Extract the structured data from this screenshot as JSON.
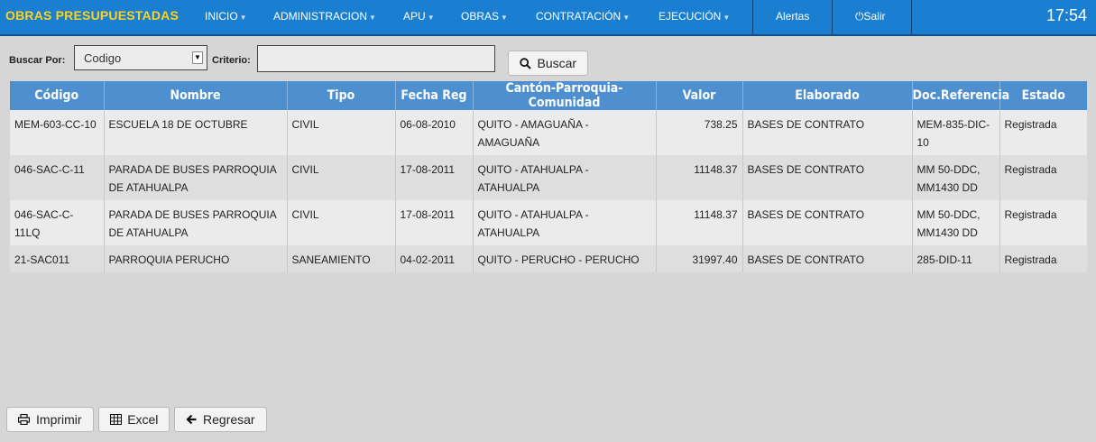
{
  "nav": {
    "brand": "OBRAS PRESUPUESTADAS",
    "menu": [
      {
        "label": "INICIO"
      },
      {
        "label": "ADMINISTRACION"
      },
      {
        "label": "APU"
      },
      {
        "label": "OBRAS"
      },
      {
        "label": "CONTRATACIÓN"
      },
      {
        "label": "EJECUCIÓN"
      }
    ],
    "alerts": "Alertas",
    "logout": "Salir",
    "time": "17:54"
  },
  "search": {
    "buscar_por_label": "Buscar Por:",
    "selected_option": "Codigo",
    "criterio_label": "Criterio:",
    "criterio_value": "",
    "button_label": "Buscar"
  },
  "table": {
    "headers": [
      "Código",
      "Nombre",
      "Tipo",
      "Fecha Reg",
      "Cantón-Parroquia-Comunidad",
      "Valor",
      "Elaborado",
      "Doc.Referencia",
      "Estado"
    ],
    "rows": [
      [
        "MEM-603-CC-10",
        "ESCUELA 18 DE OCTUBRE",
        "CIVIL",
        "06-08-2010",
        "QUITO - AMAGUAÑA - AMAGUAÑA",
        "738.25",
        "BASES DE CONTRATO",
        "MEM-835-DIC-10",
        "Registrada"
      ],
      [
        "046-SAC-C-11",
        "PARADA DE BUSES PARROQUIA DE ATAHUALPA",
        "CIVIL",
        "17-08-2011",
        "QUITO - ATAHUALPA - ATAHUALPA",
        "11148.37",
        "BASES DE CONTRATO",
        "MM 50-DDC, MM1430 DD",
        "Registrada"
      ],
      [
        "046-SAC-C-11LQ",
        "PARADA DE BUSES PARROQUIA DE ATAHUALPA",
        "CIVIL",
        "17-08-2011",
        "QUITO - ATAHUALPA - ATAHUALPA",
        "11148.37",
        "BASES DE CONTRATO",
        "MM 50-DDC, MM1430 DD",
        "Registrada"
      ],
      [
        "21-SAC011",
        "PARROQUIA PERUCHO",
        "SANEAMIENTO",
        "04-02-2011",
        "QUITO - PERUCHO - PERUCHO",
        "31997.40",
        "BASES DE CONTRATO",
        "285-DID-11",
        "Registrada"
      ]
    ]
  },
  "footer": {
    "print_label": "Imprimir",
    "excel_label": "Excel",
    "back_label": "Regresar"
  },
  "colors": {
    "navbar": "#1a7fd0",
    "brand": "#ffd21a",
    "table_header": "#4e8fd0"
  },
  "icons": {
    "logout": "power-icon",
    "search": "search-icon",
    "print": "print-icon",
    "excel": "table-icon",
    "back": "arrow-left-icon"
  }
}
